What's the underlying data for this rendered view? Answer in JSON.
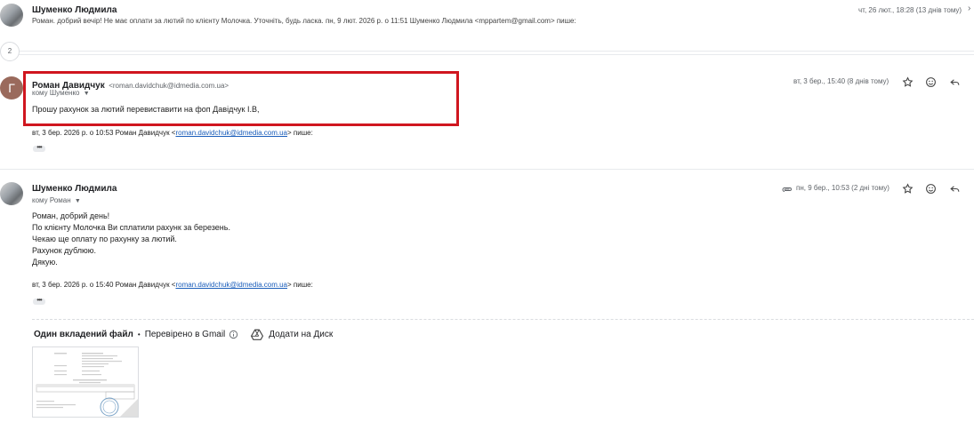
{
  "collapsed_message": {
    "sender": "Шуменко Людмила",
    "snippet": "Роман. добрий вечір! Не має оплати за лютий по клієнту Молочка. Уточніть, будь ласка. пн, 9 лют. 2026 р. о 11:51 Шуменко Людмила <mppartem@gmail.com> пише:",
    "date": "чт, 26 лют., 18:28 (13 днів тому)"
  },
  "hidden_count": "2",
  "message1": {
    "avatar_letter": "Г",
    "sender": "Роман Давидчук",
    "sender_email": "<roman.davidchuk@idmedia.com.ua>",
    "to": "кому Шуменко",
    "date": "вт, 3 бер., 15:40 (8 днів тому)",
    "body": "Прошу рахунок за лютий перевиставити на фоп Давідчук І.В,",
    "quote_prefix": "вт, 3 бер. 2026 р. о 10:53 Роман Давидчук <",
    "quote_email": "roman.davidchuk@idmedia.com.ua",
    "quote_suffix": "> пише:",
    "dots": "•••"
  },
  "message2": {
    "sender": "Шуменко Людмила",
    "to": "кому Роман",
    "date": "пн, 9 бер., 10:53 (2 дні тому)",
    "body_lines": [
      "Роман, добрий день!",
      "По клієнту Молочка Ви сплатили рахунк за березень.",
      "Чекаю ще оплату по рахунку за лютий.",
      "Рахунок дублюю.",
      "Дякую."
    ],
    "quote_prefix": "вт, 3 бер. 2026 р. о 15:40 Роман Давидчук <",
    "quote_email": "roman.davidchuk@idmedia.com.ua",
    "quote_suffix": "> пише:",
    "dots": "•••"
  },
  "attachments": {
    "title": "Один вкладений файл",
    "separator": "•",
    "checked": "Перевірено в Gmail",
    "add_to_drive": "Додати на Диск"
  },
  "colors": {
    "highlight": "#d0161f",
    "link": "#1a5dba"
  }
}
